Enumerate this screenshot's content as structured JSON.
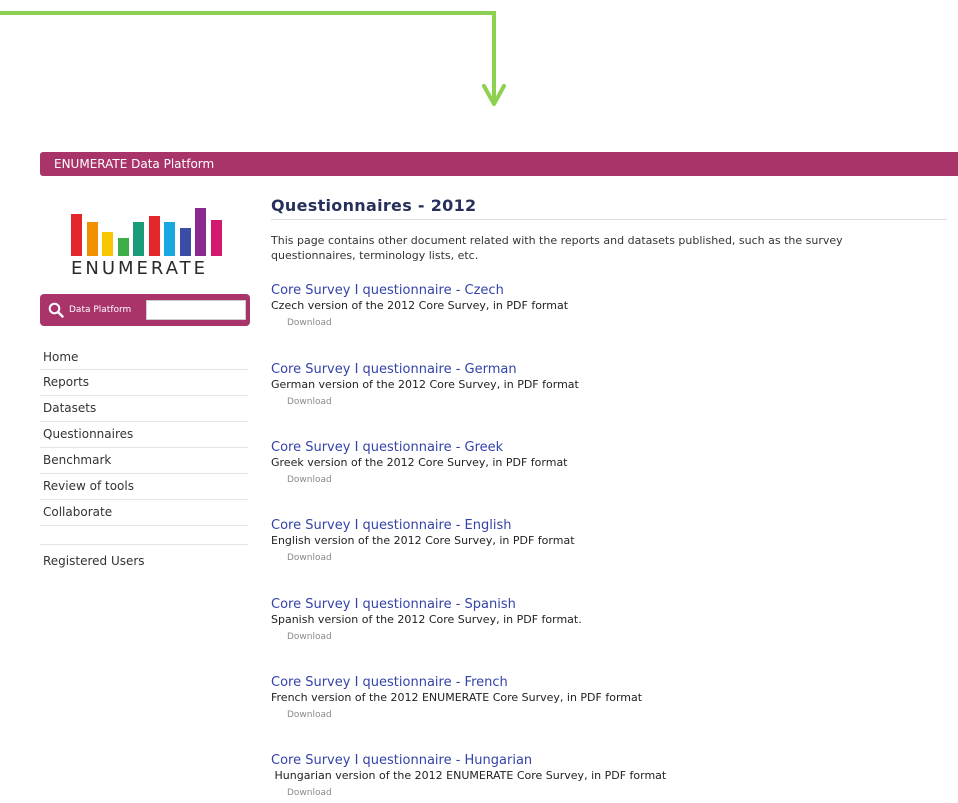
{
  "app": {
    "title": "ENUMERATE Data Platform"
  },
  "logo": {
    "wordmark": "ENUMERATE",
    "bar_colors": [
      "#e3262b",
      "#f29100",
      "#f6c700",
      "#3fae4a",
      "#1a9c7a",
      "#e3262b",
      "#19a7df",
      "#3b4ea6",
      "#8b2a8e",
      "#d3186f"
    ]
  },
  "search": {
    "label": "Data Platform",
    "value": ""
  },
  "nav": {
    "items": [
      {
        "label": "Home"
      },
      {
        "label": "Reports"
      },
      {
        "label": "Datasets"
      },
      {
        "label": "Questionnaires"
      },
      {
        "label": "Benchmark"
      },
      {
        "label": "Review of tools"
      },
      {
        "label": "Collaborate"
      }
    ],
    "registered": "Registered Users"
  },
  "main": {
    "heading": "Questionnaires - 2012",
    "intro": "This page contains other document related with the reports and datasets published, such as the survey questionnaires, terminology lists, etc.",
    "documents": [
      {
        "title": "Core Survey I questionnaire - Czech",
        "description": "Czech version of the 2012 Core Survey, in PDF format",
        "download": "Download"
      },
      {
        "title": "Core Survey I questionnaire - German",
        "description": "German version of the 2012 Core Survey, in PDF format",
        "download": "Download"
      },
      {
        "title": "Core Survey I questionnaire - Greek",
        "description": "Greek version of the 2012 Core Survey, in PDF format",
        "download": "Download"
      },
      {
        "title": "Core Survey I questionnaire - English",
        "description": "English version of the 2012 Core Survey, in PDF format",
        "download": "Download"
      },
      {
        "title": "Core Survey I questionnaire - Spanish",
        "description": "Spanish version of the 2012 Core Survey, in PDF format.",
        "download": "Download"
      },
      {
        "title": "Core Survey I questionnaire - French",
        "description": "French version of the 2012 ENUMERATE Core Survey, in PDF format",
        "download": "Download"
      },
      {
        "title": "Core Survey I questionnaire - Hungarian",
        "description": " Hungarian version of the 2012 ENUMERATE Core Survey, in PDF format",
        "download": "Download"
      }
    ]
  },
  "colors": {
    "brand": "#a8346a",
    "heading": "#26305a",
    "link": "#3343a8",
    "annotation": "#8cd14f"
  },
  "icons": {
    "search": "magnifier-icon",
    "annotation": "arrow-down-icon"
  }
}
